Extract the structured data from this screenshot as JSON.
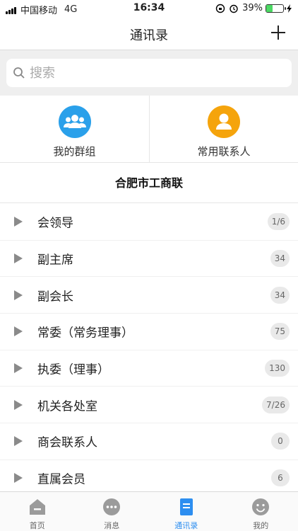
{
  "status_bar": {
    "carrier": "中国移动",
    "network": "4G",
    "time": "16:34",
    "battery": "39%",
    "battery_level": 0.39
  },
  "header": {
    "title": "通讯录",
    "add_icon": "plus-icon"
  },
  "search": {
    "placeholder": "搜索",
    "icon": "search-icon"
  },
  "quick_links": [
    {
      "label": "我的群组",
      "icon": "group-icon",
      "color": "#2aa0ea"
    },
    {
      "label": "常用联系人",
      "icon": "person-icon",
      "color": "#f5a40c"
    }
  ],
  "org_title": "合肥市工商联",
  "departments": [
    {
      "label": "会领导",
      "count": "1/6"
    },
    {
      "label": "副主席",
      "count": "34"
    },
    {
      "label": "副会长",
      "count": "34"
    },
    {
      "label": "常委（常务理事）",
      "count": "75"
    },
    {
      "label": "执委（理事）",
      "count": "130"
    },
    {
      "label": "机关各处室",
      "count": "7/26"
    },
    {
      "label": "商会联系人",
      "count": "0"
    },
    {
      "label": "直属会员",
      "count": "6"
    }
  ],
  "tabs": [
    {
      "label": "首页",
      "icon": "home-icon",
      "active": false
    },
    {
      "label": "消息",
      "icon": "message-icon",
      "active": false
    },
    {
      "label": "通讯录",
      "icon": "contacts-icon",
      "active": true
    },
    {
      "label": "我的",
      "icon": "profile-icon",
      "active": false
    }
  ],
  "colors": {
    "accent": "#2d8ef0",
    "group_blue": "#2aa0ea",
    "contact_orange": "#f5a40c",
    "inactive_icon": "#9b9b9b"
  }
}
